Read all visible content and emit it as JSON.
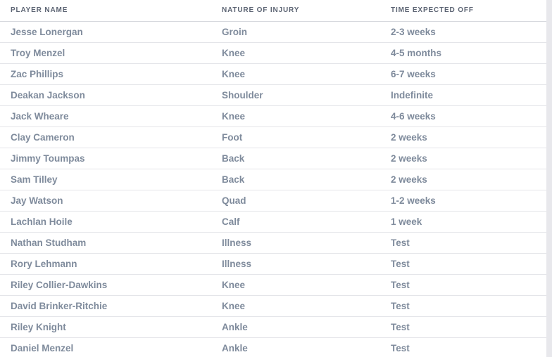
{
  "table": {
    "columns": [
      {
        "key": "player_name",
        "label": "PLAYER NAME"
      },
      {
        "key": "nature_of_injury",
        "label": "NATURE OF INJURY"
      },
      {
        "key": "time_expected_off",
        "label": "TIME EXPECTED OFF"
      }
    ],
    "rows": [
      {
        "player_name": "Jesse Lonergan",
        "nature_of_injury": "Groin",
        "time_expected_off": "2-3 weeks"
      },
      {
        "player_name": "Troy Menzel",
        "nature_of_injury": "Knee",
        "time_expected_off": "4-5 months"
      },
      {
        "player_name": "Zac Phillips",
        "nature_of_injury": "Knee",
        "time_expected_off": "6-7 weeks"
      },
      {
        "player_name": "Deakan Jackson",
        "nature_of_injury": "Shoulder",
        "time_expected_off": "Indefinite"
      },
      {
        "player_name": "Jack Wheare",
        "nature_of_injury": "Knee",
        "time_expected_off": "4-6 weeks"
      },
      {
        "player_name": "Clay Cameron",
        "nature_of_injury": "Foot",
        "time_expected_off": "2 weeks"
      },
      {
        "player_name": "Jimmy Toumpas",
        "nature_of_injury": "Back",
        "time_expected_off": "2 weeks"
      },
      {
        "player_name": "Sam Tilley",
        "nature_of_injury": "Back",
        "time_expected_off": "2 weeks"
      },
      {
        "player_name": "Jay Watson",
        "nature_of_injury": "Quad",
        "time_expected_off": "1-2 weeks"
      },
      {
        "player_name": "Lachlan Hoile",
        "nature_of_injury": "Calf",
        "time_expected_off": "1 week"
      },
      {
        "player_name": "Nathan Studham",
        "nature_of_injury": "Illness",
        "time_expected_off": "Test"
      },
      {
        "player_name": "Rory Lehmann",
        "nature_of_injury": "Illness",
        "time_expected_off": "Test"
      },
      {
        "player_name": "Riley Collier-Dawkins",
        "nature_of_injury": "Knee",
        "time_expected_off": "Test"
      },
      {
        "player_name": "David Brinker-Ritchie",
        "nature_of_injury": "Knee",
        "time_expected_off": "Test"
      },
      {
        "player_name": "Riley Knight",
        "nature_of_injury": "Ankle",
        "time_expected_off": "Test"
      },
      {
        "player_name": "Daniel Menzel",
        "nature_of_injury": "Ankle",
        "time_expected_off": "Test"
      }
    ]
  },
  "colors": {
    "header_text": "#5c6473",
    "cell_text": "#7f8b9c",
    "row_border": "#e4e5e9",
    "header_border": "#d6d8dd",
    "table_background": "#ffffff",
    "page_background": "#e8e8ec"
  }
}
